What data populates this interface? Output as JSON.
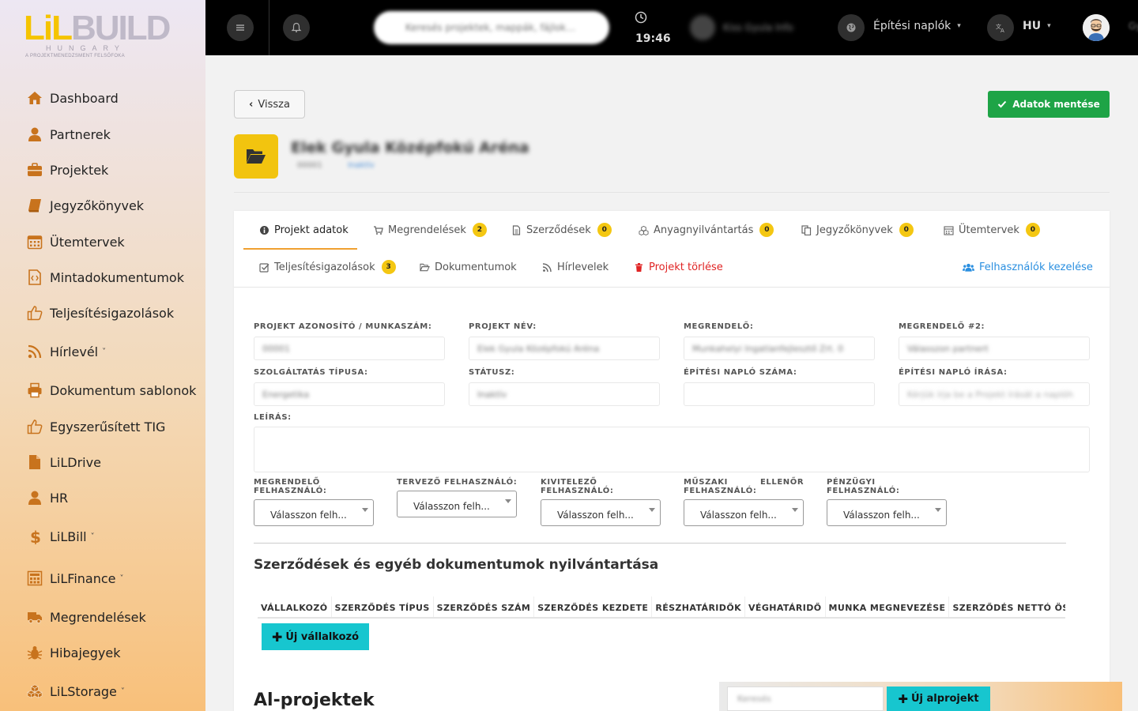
{
  "logo": {
    "text_li": "LiL",
    "text_rest": "BUILD",
    "sub": "HUNGARY",
    "tagline": "A PROJEKTMENEDZSMENT FELSŐFOKA"
  },
  "sidebar": {
    "items": [
      {
        "label": "Dashboard",
        "icon": "home-icon"
      },
      {
        "label": "Partnerek",
        "icon": "user-icon"
      },
      {
        "label": "Projektek",
        "icon": "briefcase-icon"
      },
      {
        "label": "Jegyzőkönyvek",
        "icon": "book-icon"
      },
      {
        "label": "Ütemtervek",
        "icon": "calendar-icon"
      },
      {
        "label": "Mintadokumentumok",
        "icon": "code-file-icon"
      },
      {
        "label": "Teljesítésigazolások",
        "icon": "thumbs-up-icon"
      },
      {
        "label": "Hírlevél",
        "icon": "rss-icon",
        "chevron": "˅"
      },
      {
        "label": "Dokumentum sablonok",
        "icon": "printer-icon"
      },
      {
        "label": "Egyszerűsített TIG",
        "icon": "thumbs-up-icon"
      },
      {
        "label": "LiLDrive",
        "icon": "file-icon"
      },
      {
        "label": "HR",
        "icon": "user-icon"
      },
      {
        "label": "LiLBill",
        "icon": "dollar-icon",
        "chevron": "˅"
      },
      {
        "label": "LiLFinance",
        "icon": "calculator-icon",
        "chevron": "˅"
      },
      {
        "label": "Megrendelések",
        "icon": "truck-icon"
      },
      {
        "label": "Hibajegyek",
        "icon": "bug-icon"
      },
      {
        "label": "LiLStorage",
        "icon": "cubes-icon",
        "chevron": "˅"
      }
    ]
  },
  "topbar": {
    "search_placeholder": "Keresés projektek, mappák, fájlok…",
    "time": "19:46",
    "user_name": "Kiss Gyula Info",
    "log_label": "Építési naplók",
    "lang": "HU",
    "extra": "Gyu"
  },
  "page": {
    "back_label": "Vissza",
    "save_label": "Adatok mentése",
    "project_title": "Elek Gyula Középfokú Aréna",
    "project_code": "00001",
    "project_status": "Inaktív"
  },
  "tabs": {
    "row1": [
      {
        "label": "Projekt adatok",
        "icon": "info-icon"
      },
      {
        "label": "Megrendelések",
        "icon": "cart-icon",
        "badge": "2"
      },
      {
        "label": "Szerződések",
        "icon": "document-icon",
        "badge": "0"
      },
      {
        "label": "Anyagnyilvántartás",
        "icon": "cubes-icon",
        "badge": "0"
      },
      {
        "label": "Jegyzőkönyvek",
        "icon": "copy-icon",
        "badge": "0"
      },
      {
        "label": "Ütemtervek",
        "icon": "calendar-icon",
        "badge": "0"
      }
    ],
    "row2": [
      {
        "label": "Teljesítésigazolások",
        "icon": "check-square-icon",
        "badge": "3"
      },
      {
        "label": "Dokumentumok",
        "icon": "folder-open-icon"
      },
      {
        "label": "Hírlevelek",
        "icon": "rss-icon"
      },
      {
        "label": "Projekt törlése",
        "icon": "trash-icon"
      },
      {
        "label": "Felhasználók kezelése",
        "icon": "users-icon"
      }
    ]
  },
  "fields": {
    "id_label": "PROJEKT AZONOSÍTÓ / MUNKASZÁM:",
    "id_value": "00001",
    "name_label": "PROJEKT NÉV:",
    "name_value": "Elek Gyula Középfokú Aréna",
    "client_label": "MEGRENDELŐ:",
    "client_value": "Munkahelyi Ingatlanfejlesztő Zrt. 0",
    "client2_label": "MEGRENDELŐ #2:",
    "client2_value": "Válasszon partnert",
    "service_label": "SZOLGÁLTATÁS TÍPUSA:",
    "service_value": "Energetika",
    "status_label": "STÁTUSZ:",
    "status_value": "Inaktív",
    "lognum_label": "ÉPÍTÉSI NAPLÓ SZÁMA:",
    "lognum_value": "",
    "logwrite_label": "ÉPÍTÉSI NAPLÓ ÍRÁSA:",
    "logwrite_value": "Kérjük írja be a Projekt írását a naplóh",
    "desc_label": "LEÍRÁS:",
    "desc_value": ""
  },
  "users": [
    {
      "label": "MEGRENDELŐ FELHASZNÁLÓ:",
      "value": "Válasszon felh..."
    },
    {
      "label": "TERVEZŐ FELHASZNÁLÓ:",
      "value": "Válasszon felh..."
    },
    {
      "label": "KIVITELEZŐ FELHASZNÁLÓ:",
      "value": "Válasszon felh..."
    },
    {
      "label1": "MŰSZAKI",
      "label2": "ELLENŐR",
      "label3": "FELHASZNÁLÓ:",
      "value": "Válasszon felh..."
    },
    {
      "label": "PÉNZÜGYI FELHASZNÁLÓ:",
      "value": "Válasszon felh..."
    }
  ],
  "contracts": {
    "title": "Szerződések és egyéb dokumentumok nyilvántartása",
    "columns": [
      "VÁLLALKOZÓ",
      "SZERZŐDÉS TÍPUS",
      "SZERZŐDÉS SZÁM",
      "SZERZŐDÉS KEZDETE",
      "RÉSZHATÁRIDŐK",
      "VÉGHATÁRIDŐ",
      "MUNKA MEGNEVEZÉSE",
      "SZERZŐDÉS NETTÓ ÖSSZEGE"
    ],
    "new_label": "Új vállalkozó"
  },
  "subprojects": {
    "title": "Al-projektek",
    "search_placeholder": "Keresés",
    "new_label": "Új alprojekt"
  },
  "colors": {
    "accent": "#f4c712",
    "save": "#1ea446",
    "teal": "#17c6cf",
    "danger": "#e02424",
    "link": "#2a8fe0"
  }
}
